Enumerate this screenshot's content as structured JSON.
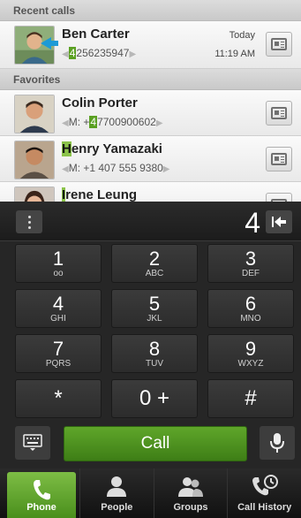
{
  "sections": {
    "recent": "Recent calls",
    "favorites": "Favorites"
  },
  "recent_call": {
    "name": "Ben Carter",
    "number_hl": "4",
    "number_rest": "256235947",
    "day": "Today",
    "time": "11:19 AM"
  },
  "favorites": [
    {
      "name": "Colin Porter",
      "number_prefix": "M: +",
      "number_hl": "4",
      "number_rest": "7700900602"
    },
    {
      "name_hl": "H",
      "name_rest": "enry Yamazaki",
      "number": "M: +1 407 555 9380"
    },
    {
      "name_hl": "I",
      "name_rest": "rene Leung"
    }
  ],
  "dialer": {
    "dialed": "4",
    "keys": [
      {
        "digit": "1",
        "letters": ""
      },
      {
        "digit": "2",
        "letters": "ABC"
      },
      {
        "digit": "3",
        "letters": "DEF"
      },
      {
        "digit": "4",
        "letters": "GHI"
      },
      {
        "digit": "5",
        "letters": "JKL"
      },
      {
        "digit": "6",
        "letters": "MNO"
      },
      {
        "digit": "7",
        "letters": "PQRS"
      },
      {
        "digit": "8",
        "letters": "TUV"
      },
      {
        "digit": "9",
        "letters": "WXYZ"
      },
      {
        "digit": "*",
        "letters": ""
      },
      {
        "digit": "0 +",
        "letters": ""
      },
      {
        "digit": "#",
        "letters": ""
      }
    ],
    "call_label": "Call"
  },
  "tabs": [
    {
      "label": "Phone",
      "icon": "phone-icon"
    },
    {
      "label": "People",
      "icon": "person-icon"
    },
    {
      "label": "Groups",
      "icon": "group-icon"
    },
    {
      "label": "Call History",
      "icon": "call-history-icon"
    }
  ],
  "colors": {
    "accent": "#5aa022",
    "highlight": "#8bc34a"
  }
}
